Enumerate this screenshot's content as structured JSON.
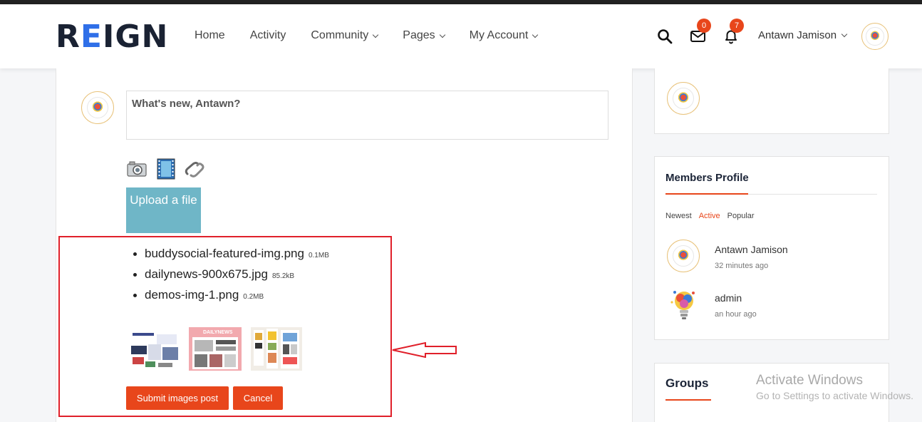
{
  "header": {
    "logo": {
      "pre": "R",
      "mid": "E",
      "post": "IGN"
    },
    "nav": [
      {
        "label": "Home"
      },
      {
        "label": "Activity"
      },
      {
        "label": "Community"
      },
      {
        "label": "Pages"
      },
      {
        "label": "My Account"
      }
    ],
    "messages_badge": "0",
    "notifications_badge": "7",
    "user_name": "Antawn Jamison"
  },
  "post_form": {
    "placeholder": "What's new, Antawn?",
    "upload_label": "Upload a file",
    "files": [
      {
        "name": "buddysocial-featured-img.png",
        "size": "0.1MB"
      },
      {
        "name": "dailynews-900x675.jpg",
        "size": "85.2kB"
      },
      {
        "name": "demos-img-1.png",
        "size": "0.2MB"
      }
    ],
    "thumbnail_preview_text": "DAILYNEWS",
    "submit_label": "Submit images post",
    "cancel_label": "Cancel"
  },
  "sidebar": {
    "members_title": "Members Profile",
    "tabs": [
      "Newest",
      "Active",
      "Popular"
    ],
    "active_tab": "Active",
    "members": [
      {
        "name": "Antawn Jamison",
        "time": "32 minutes ago"
      },
      {
        "name": "admin",
        "time": "an hour ago"
      }
    ],
    "groups_title": "Groups"
  },
  "watermark": {
    "line1": "Activate Windows",
    "line2": "Go to Settings to activate Windows."
  },
  "colors": {
    "accent": "#e8461b",
    "upload_button": "#6fb6c7",
    "highlight_frame": "#e0202a",
    "logo_accent": "#2f6fe8"
  }
}
